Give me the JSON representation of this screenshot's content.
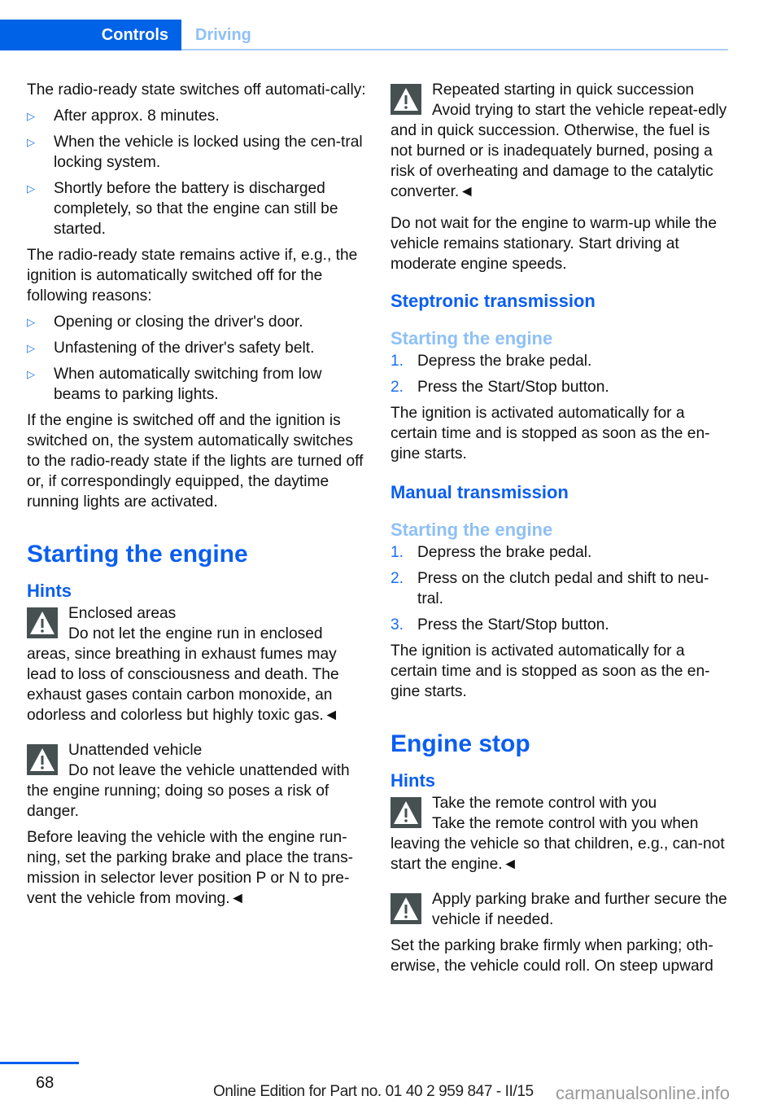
{
  "tabs": [
    {
      "label": "Controls",
      "active": true
    },
    {
      "label": "Driving",
      "active": false
    }
  ],
  "left": {
    "intro": "The radio-ready state switches off automati-cally:",
    "list1": [
      "After approx. 8 minutes.",
      "When the vehicle is locked using the cen-tral locking system.",
      "Shortly before the battery is discharged completely, so that the engine can still be started."
    ],
    "para2": "The radio-ready state remains active if, e.g., the ignition is automatically switched off for the following reasons:",
    "list2": [
      "Opening or closing the driver's door.",
      "Unfastening of the driver's safety belt.",
      "When automatically switching from low beams to parking lights."
    ],
    "para3": "If the engine is switched off and the ignition is switched on, the system automatically switches to the radio-ready state if the lights are turned off or, if correspondingly equipped, the daytime running lights are activated.",
    "heading": "Starting the engine",
    "subheading": "Hints",
    "warn1": {
      "title": "Enclosed areas",
      "body": "Do not let the engine run in enclosed areas, since breathing in exhaust fumes may lead to loss of consciousness and death. The exhaust gases contain carbon monoxide, an odorless and colorless but highly toxic gas.◄"
    },
    "warn2": {
      "title": "Unattended vehicle",
      "body": "Do not leave the vehicle unattended with the engine running; doing so poses a risk of danger."
    },
    "para4": "Before leaving the vehicle with the engine run-ning, set the parking brake and place the trans-mission in selector lever position P or N to pre-vent the vehicle from moving.◄"
  },
  "right": {
    "warn3": {
      "title": "Repeated starting in quick succession",
      "body": "Avoid trying to start the vehicle repeat-edly and in quick succession. Otherwise, the fuel is not burned or is inadequately burned, posing a risk of overheating and damage to the catalytic converter.◄"
    },
    "para1": "Do not wait for the engine to warm-up while the vehicle remains stationary. Start driving at moderate engine speeds.",
    "steptronic": {
      "heading": "Steptronic transmission",
      "subheading": "Starting the engine",
      "steps": [
        {
          "n": "1.",
          "t": "Depress the brake pedal."
        },
        {
          "n": "2.",
          "t": "Press the Start/Stop button."
        }
      ],
      "note": "The ignition is activated automatically for a certain time and is stopped as soon as the en-gine starts."
    },
    "manual": {
      "heading": "Manual transmission",
      "subheading": "Starting the engine",
      "steps": [
        {
          "n": "1.",
          "t": "Depress the brake pedal."
        },
        {
          "n": "2.",
          "t": "Press on the clutch pedal and shift to neu-tral."
        },
        {
          "n": "3.",
          "t": "Press the Start/Stop button."
        }
      ],
      "note": "The ignition is activated automatically for a certain time and is stopped as soon as the en-gine starts."
    },
    "heading": "Engine stop",
    "subheading": "Hints",
    "warn4": {
      "title": "Take the remote control with you",
      "body": "Take the remote control with you when leaving the vehicle so that children, e.g., can-not start the engine.◄"
    },
    "warn5": {
      "title": "Apply parking brake and further secure the vehicle if needed."
    },
    "para2": "Set the parking brake firmly when parking; oth-erwise, the vehicle could roll. On steep upward"
  },
  "footer": {
    "page": "68",
    "edition": "Online Edition for Part no. 01 40 2 959 847 - II/15",
    "watermark": "carmanualsonline.info"
  },
  "icons": {
    "bullet": "▷"
  }
}
